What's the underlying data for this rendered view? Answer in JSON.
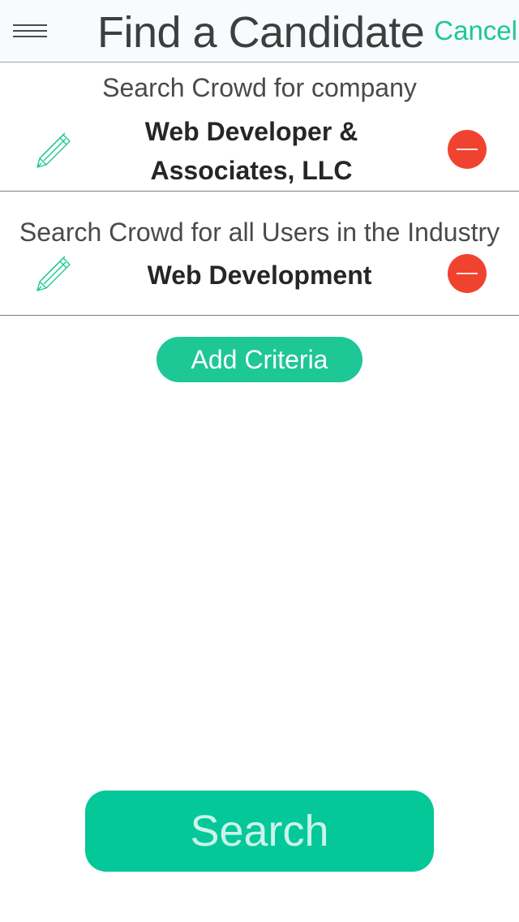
{
  "header": {
    "menu_icon": "hamburger-menu-icon",
    "title": "Find a Candidate",
    "cancel_label": "Cancel"
  },
  "criteria": [
    {
      "description": "Search Crowd for company",
      "value_line_1": "Web Developer &",
      "value_line_2": "Associates, LLC",
      "edit_icon": "pencil-icon",
      "remove_icon": "minus-circle-icon"
    },
    {
      "description": "Search Crowd for all Users in the Industry",
      "value_line_1": "Web Development",
      "edit_icon": "pencil-icon",
      "remove_icon": "minus-circle-icon"
    }
  ],
  "add_criteria_label": "Add Criteria",
  "search_label": "Search",
  "colors": {
    "accent": "#1ec796",
    "remove": "#f0432f",
    "header_bg": "#f7fbfd"
  }
}
